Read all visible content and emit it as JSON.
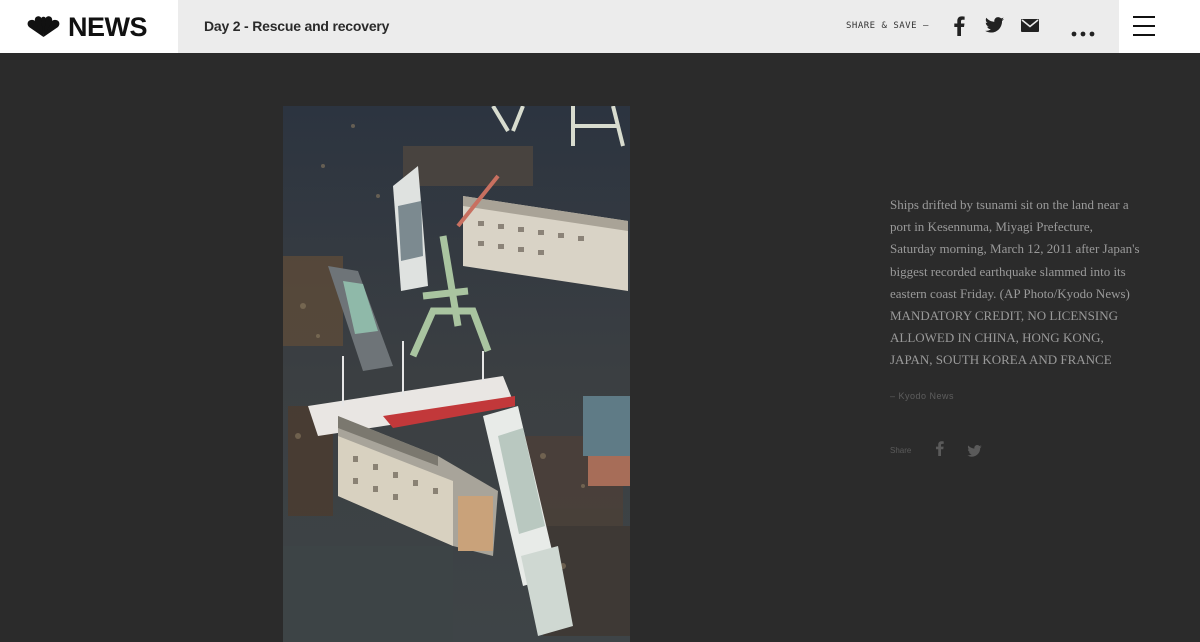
{
  "header": {
    "logo_text": "NEWS",
    "story_title": "Day 2 - Rescue and recovery",
    "share_save_label": "SHARE & SAVE –",
    "icons": [
      "facebook-icon",
      "twitter-icon",
      "email-icon",
      "more-icon",
      "menu-icon"
    ]
  },
  "photo": {
    "subject": "Aerial view of ships stranded on land among tsunami debris"
  },
  "caption": {
    "text": "Ships drifted by tsunami sit on the land near a port in Kesennuma, Miyagi Prefecture, Saturday morning, March 12, 2011 after Japan's biggest recorded earthquake slammed into its eastern coast Friday. (AP Photo/Kyodo News) MANDATORY CREDIT, NO LICENSING ALLOWED IN CHINA, HONG KONG, JAPAN, SOUTH KOREA AND FRANCE",
    "credit": "– Kyodo News",
    "share_label": "Share"
  },
  "colors": {
    "background": "#2b2b2b",
    "header_bg": "#ffffff",
    "titlebar_bg": "#ececec",
    "caption_text": "#9a9a9a"
  }
}
